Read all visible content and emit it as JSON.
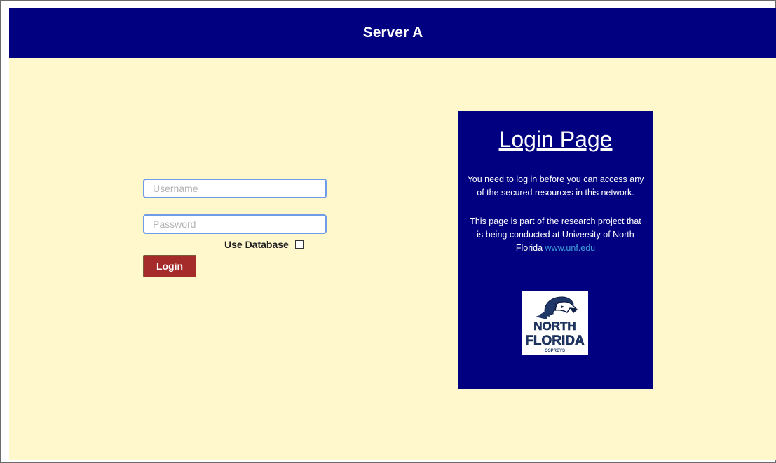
{
  "header": {
    "title": "Server A"
  },
  "form": {
    "username_placeholder": "Username",
    "username_value": "",
    "password_placeholder": "Password",
    "password_value": "",
    "use_database_label": "Use Database",
    "use_database_checked": false,
    "login_label": "Login"
  },
  "panel": {
    "title": "Login Page",
    "text1": "You need to log in before you can access any of the secured resources in this network.",
    "text2_prefix": "This page is part of the research project that is being conducted at University of North Florida ",
    "link_text": "www.unf.edu",
    "logo": {
      "line1": "NORTH",
      "line2": "FLORIDA",
      "line3": "OSPREYS"
    }
  },
  "colors": {
    "header_bg": "#000080",
    "content_bg": "#fff8cd",
    "button_bg": "#a52a2a",
    "link": "#3f9fd8",
    "input_border": "#6f9ce6"
  }
}
